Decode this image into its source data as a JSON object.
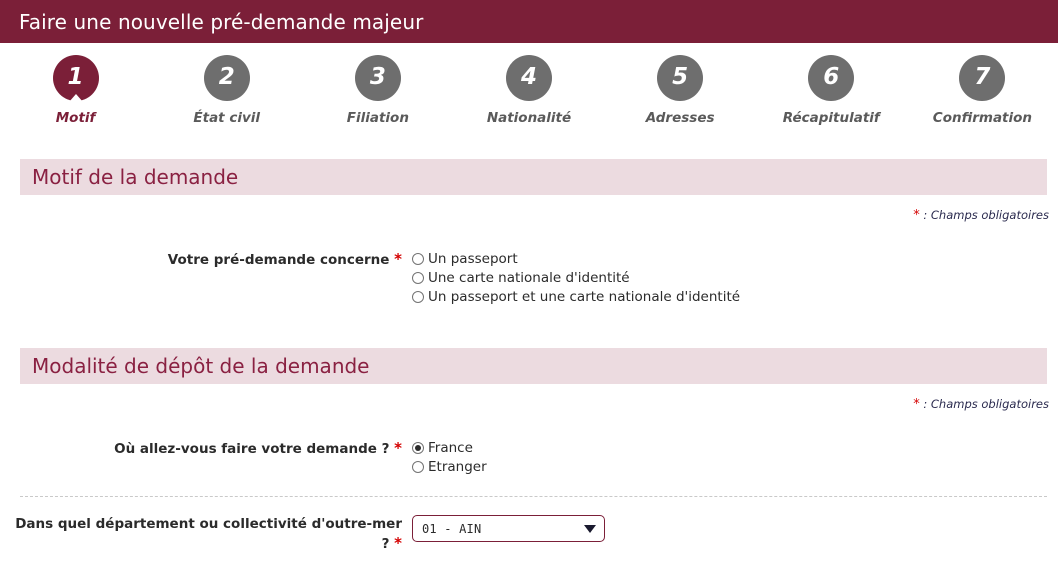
{
  "header": {
    "title": "Faire une nouvelle pré-demande majeur",
    "bg_color": "#7b1f38",
    "text_color": "#ffffff"
  },
  "stepper": {
    "active_index": 0,
    "active_color": "#7b1f38",
    "inactive_color": "#6e6e6e",
    "steps": [
      {
        "number": "1",
        "label": "Motif"
      },
      {
        "number": "2",
        "label": "État civil"
      },
      {
        "number": "3",
        "label": "Filiation"
      },
      {
        "number": "4",
        "label": "Nationalité"
      },
      {
        "number": "5",
        "label": "Adresses"
      },
      {
        "number": "6",
        "label": "Récapitulatif"
      },
      {
        "number": "7",
        "label": "Confirmation"
      }
    ]
  },
  "sections": [
    {
      "title": "Motif de la demande",
      "required_note": ": Champs obligatoires",
      "required_star": "*",
      "question": {
        "label": "Votre pré-demande concerne",
        "star": "*",
        "options": [
          {
            "label": "Un passeport",
            "checked": false
          },
          {
            "label": "Une carte nationale d'identité",
            "checked": false
          },
          {
            "label": "Un passeport et une carte nationale d'identité",
            "checked": false
          }
        ]
      }
    },
    {
      "title": "Modalité de dépôt de la demande",
      "required_note": ": Champs obligatoires",
      "required_star": "*",
      "question": {
        "label": "Où allez-vous faire votre demande ?",
        "star": "*",
        "options": [
          {
            "label": "France",
            "checked": true
          },
          {
            "label": "Etranger",
            "checked": false
          }
        ]
      },
      "department": {
        "label_line1": "Dans quel département ou collectivité d'outre-mer",
        "label_line2": "?",
        "star": "*",
        "selected_value": "01 - AIN",
        "border_color": "#7b1f38"
      }
    }
  ]
}
